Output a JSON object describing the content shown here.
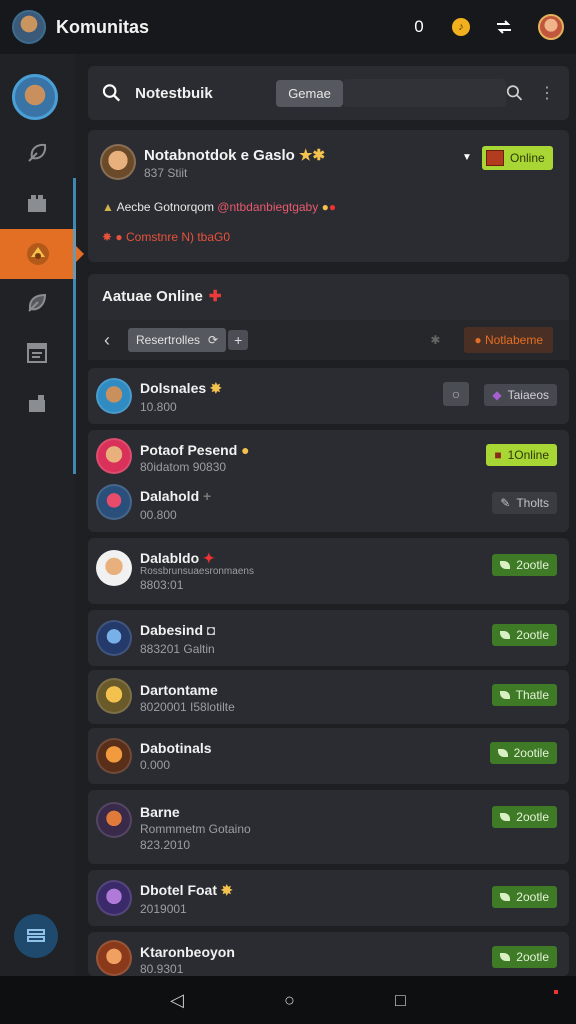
{
  "app": {
    "title": "Komunitas"
  },
  "topbar": {
    "count": "0",
    "coin_glyph": "♪"
  },
  "search": {
    "query": "Notestbuik",
    "chip": "Gemae"
  },
  "profile": {
    "name": "Notabnotdok e Gaslo",
    "stars": "★✱",
    "sub": "837 Stiit",
    "online_label": "Online",
    "line1_prefix": "Aecbe Gotnorqom",
    "line1_handle": "@ntbdanbiegtgaby",
    "line2": "Comstnre N) tbaG0"
  },
  "section": {
    "title": "Aatuae Online",
    "filter": "Resertrolles",
    "notif": "Notlabeme"
  },
  "rows": [
    {
      "name": "Dolsnales",
      "badge": "✸",
      "sub": "10.800",
      "btn": "Taiaeos",
      "btn_style": "grey"
    },
    {
      "name": "Potaof Pesend",
      "badge": "●",
      "sub": "80idatom   90830",
      "btn": "1Online",
      "btn_style": "lime"
    },
    {
      "name": "Dalahold",
      "badge": "+",
      "sub": "00.800",
      "btn": "Tholts",
      "btn_style": "dark"
    },
    {
      "name": "Dalabldo",
      "badge": "✦",
      "sub": "Rossbrunsuaesronmaens",
      "sub2": "8803:01",
      "btn": "2ootle",
      "btn_style": "green"
    },
    {
      "name": "Dabesind",
      "badge": "◘",
      "sub": "883201      Galtin",
      "btn": "2ootle",
      "btn_style": "green"
    },
    {
      "name": "Dartontame",
      "badge": "",
      "sub": "8020001     I58lotilte",
      "btn": "Thatle",
      "btn_style": "green"
    },
    {
      "name": "Dabotinals",
      "badge": "",
      "sub": "0.000",
      "btn": "2ootile",
      "btn_style": "green"
    },
    {
      "name": "Barne",
      "badge": "",
      "sub": "Rommmetm Gotaino",
      "sub2": "823.2010",
      "btn": "2ootle",
      "btn_style": "green"
    },
    {
      "name": "Dbotel Foat",
      "badge": "✸",
      "sub": "2019001",
      "btn": "2ootle",
      "btn_style": "green"
    },
    {
      "name": "Ktaronbeoyon",
      "badge": "",
      "sub": "80.9301",
      "btn": "2ootle",
      "btn_style": "green"
    }
  ],
  "colors": {
    "accent": "#e36f24",
    "online": "#a8d634",
    "button_green": "#3f7a26"
  }
}
